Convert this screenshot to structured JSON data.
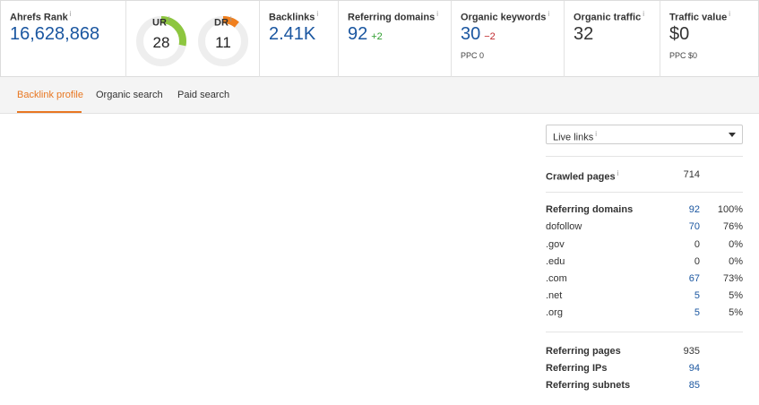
{
  "metrics": {
    "ahrefs_rank": {
      "label": "Ahrefs Rank",
      "value": "16,628,868"
    },
    "ur": {
      "label": "UR",
      "value": "28",
      "fraction": 0.28,
      "color": "#8dc63f"
    },
    "dr": {
      "label": "DR",
      "value": "11",
      "fraction": 0.11,
      "color": "#f07f1d"
    },
    "backlinks": {
      "label": "Backlinks",
      "value": "2.41K"
    },
    "referring_domains": {
      "label": "Referring domains",
      "value": "92",
      "delta": "+2"
    },
    "organic_keywords": {
      "label": "Organic keywords",
      "value": "30",
      "delta": "−2",
      "sub": "PPC 0"
    },
    "organic_traffic": {
      "label": "Organic traffic",
      "value": "32"
    },
    "traffic_value": {
      "label": "Traffic value",
      "value": "$0",
      "sub": "PPC $0"
    },
    "info_glyph": "i"
  },
  "tabs": [
    {
      "label": "Backlink profile",
      "active": true
    },
    {
      "label": "Organic search",
      "active": false
    },
    {
      "label": "Paid search",
      "active": false
    }
  ],
  "panel": {
    "select_value": "Live links",
    "crawled_pages": {
      "label": "Crawled pages",
      "value": "714"
    },
    "referring_domains": [
      {
        "label": "Referring domains",
        "value": "92",
        "pct": "100%"
      },
      {
        "label": "dofollow",
        "value": "70",
        "pct": "76%"
      },
      {
        "label": ".gov",
        "value": "0",
        "pct": "0%"
      },
      {
        "label": ".edu",
        "value": "0",
        "pct": "0%"
      },
      {
        "label": ".com",
        "value": "67",
        "pct": "73%"
      },
      {
        "label": ".net",
        "value": "5",
        "pct": "5%"
      },
      {
        "label": ".org",
        "value": "5",
        "pct": "5%"
      }
    ],
    "referring_stats": [
      {
        "label": "Referring pages",
        "value": "935"
      },
      {
        "label": "Referring IPs",
        "value": "94"
      },
      {
        "label": "Referring subnets",
        "value": "85"
      }
    ]
  }
}
